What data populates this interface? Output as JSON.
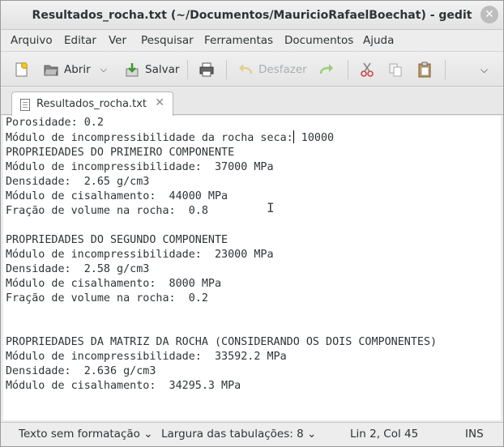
{
  "window": {
    "title": "Resultados_rocha.txt (~/Documentos/MauricioRafaelBoechat) - gedit"
  },
  "menu": [
    "Arquivo",
    "Editar",
    "Ver",
    "Pesquisar",
    "Ferramentas",
    "Documentos",
    "Ajuda"
  ],
  "toolbar": {
    "open_label": "Abrir",
    "save_label": "Salvar",
    "undo_label": "Desfazer"
  },
  "tab": {
    "label": "Resultados_rocha.txt"
  },
  "editor": {
    "line1": "Porosidade: 0.2",
    "line2_before": "Módulo de incompressibilidade da rocha seca:",
    "line2_after": " 10000",
    "body": "\nPROPRIEDADES DO PRIMEIRO COMPONENTE\nMódulo de incompressibilidade:  37000 MPa\nDensidade:  2.65 g/cm3\nMódulo de cisalhamento:  44000 MPa\nFração de volume na rocha:  0.8\n\nPROPRIEDADES DO SEGUNDO COMPONENTE\nMódulo de incompressibilidade:  23000 MPa\nDensidade:  2.58 g/cm3\nMódulo de cisalhamento:  8000 MPa\nFração de volume na rocha:  0.2\n\n\nPROPRIEDADES DA MATRIZ DA ROCHA (CONSIDERANDO OS DOIS COMPONENTES)\nMódulo de incompressibilidade:  33592.2 MPa\nDensidade:  2.636 g/cm3\nMódulo de cisalhamento:  34295.3 MPa"
  },
  "status": {
    "syntax": "Texto sem formatação",
    "tab_width": "Largura das tabulações:  8",
    "position": "Lin 2, Col 45",
    "mode": "INS"
  }
}
